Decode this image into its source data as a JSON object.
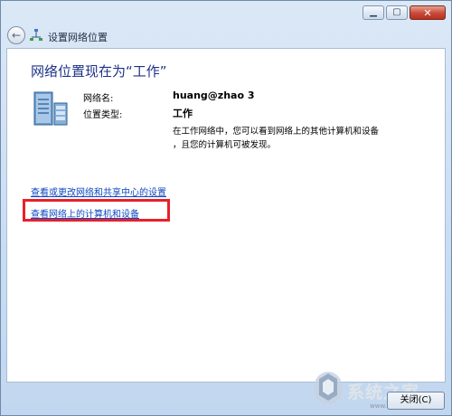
{
  "window": {
    "title": "设置网络位置",
    "controls": {
      "minimize_icon": "minimize-icon",
      "maximize_icon": "maximize-icon",
      "close_icon": "close-icon"
    }
  },
  "main": {
    "heading": "网络位置现在为“工作”",
    "network_name_label": "网络名:",
    "network_name_value": "huang@zhao  3",
    "location_type_label": "位置类型:",
    "location_type_value": "工作",
    "description_line1": "在工作网络中，您可以看到网络上的其他计算机和设备",
    "description_line2": "，且您的计算机可被发现。",
    "links": [
      "查看或更改网络和共享中心的设置",
      "查看网络上的计算机和设备"
    ]
  },
  "footer": {
    "close_button": "关闭(C)"
  },
  "watermark": {
    "text": "系统之家",
    "url": "www.xitongzhijia.net"
  },
  "colors": {
    "heading": "#1e3287",
    "link": "#0d48c2",
    "highlight_box": "#e8202b",
    "chrome": "#c9ddf2"
  }
}
